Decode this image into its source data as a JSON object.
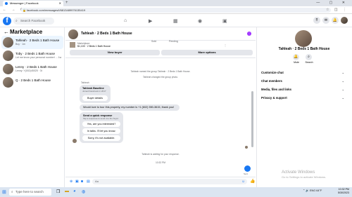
{
  "browser": {
    "tab_title": "Messenger | Facebook",
    "url": "facebook.com/messages/t/6813489976135419",
    "new_tab": "+",
    "window_controls": "— ▢ ✕",
    "nav": "← → ⟳",
    "url_icons": "☆ ◫ ⋮"
  },
  "fb": {
    "logo": "f",
    "search_placeholder": "Search Facebook"
  },
  "sidebar": {
    "title": "Marketplace",
    "conversations": [
      {
        "title": "Tahleah · 2 Beds 1 Bath House",
        "sub": "Buy · 1m",
        "active": true
      },
      {
        "title": "Toby · 2 Beds 1 Bath House",
        "sub": "Let me know your personal number! ... 1w",
        "active": false
      },
      {
        "title": "Lenny · 2 Beds 1 Bath House",
        "sub": "Lenny: Y(002)45025 · 3t",
        "active": false
      },
      {
        "title": "Q · 2 Beds 1 Bath House",
        "sub": "",
        "active": false
      }
    ]
  },
  "chat": {
    "title": "Tahleah · 2 Beds 1 Bath House",
    "listing_line1": "Marketplace",
    "listing_line2": "$1,100 · 2 Beds 1 Bath House",
    "listing_mark": "⋮",
    "view_buyer": "View buyer",
    "more_options": "More options",
    "sold_label": "Sold",
    "pending_label": "Pending",
    "messages": {
      "system1": "Tahleah named the group Tahleah · 2 Beds 1 Bath House.",
      "system2": "Tahleah changed the group photo.",
      "sender_name": "Tahleah",
      "card_title": "Tahleah Baseline",
      "card_sub": "Joined Facebook in 2017",
      "card_button": "Buyer details",
      "outgoing": "Would love to tour this property, my number is +1 (602) 550-3615, thank you!",
      "quick_title": "Send a quick response",
      "quick_sub": "Tap a response to send it to the buyer.",
      "quick1": "Yes, are you interested?",
      "quick2": "In talks. I'll let you know.",
      "quick3": "Sorry, it's not available.",
      "waiting": "Tahleah is waiting for your response.",
      "time": "10:32 PM",
      "sent": "Sent"
    },
    "compose_placeholder": "Aa"
  },
  "right_panel": {
    "name": "Tahleah · 2 Beds 1 Bath House",
    "mute_label": "Mute",
    "search_label": "Search",
    "sections": [
      "Customize chat",
      "Chat members",
      "Media, files and links",
      "Privacy & support"
    ]
  },
  "watermark": {
    "line1": "Activate Windows",
    "line2": "Go to Settings to activate Windows."
  },
  "taskbar": {
    "search_placeholder": "Type here to search",
    "tray": "⌃ 🔊 ENG 64°F",
    "time": "10:32 PM",
    "date": "5/30/2023"
  },
  "colors": {
    "accent": "#1877f2",
    "purple": "#a033ff"
  }
}
